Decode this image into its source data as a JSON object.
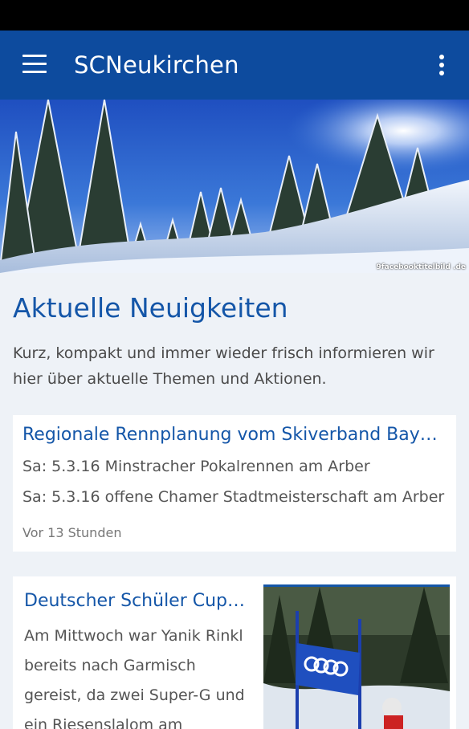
{
  "app": {
    "title": "SCNeukirchen"
  },
  "icons": {
    "menu": "hamburger-menu-icon",
    "overflow": "more-vertical-icon"
  },
  "hero": {
    "credit": "9facebooktitelbild .de"
  },
  "section": {
    "title": "Aktuelle Neuigkeiten",
    "description": "Kurz, kompakt und immer wieder frisch informieren wir hier über aktuelle Themen und Aktionen."
  },
  "news": [
    {
      "title": "Regionale Rennplanung vom Skiverband Bayerischer Wald",
      "lines": [
        "Sa: 5.3.16 Minstracher Pokalrennen am Arber",
        "Sa: 5.3.16 offene Chamer Stadtmeisterschaft am Arber"
      ],
      "time": "Vor 13 Stunden"
    },
    {
      "title": "Deutscher Schüler Cup in Garmisch",
      "text": "Am Mittwoch war Yanik Rinkl bereits nach Garmisch gereist, da zwei Super-G und ein Riesenslalom am"
    }
  ],
  "colors": {
    "primary": "#0d4b9e",
    "accent": "#1456a8",
    "background": "#eef2f7"
  }
}
